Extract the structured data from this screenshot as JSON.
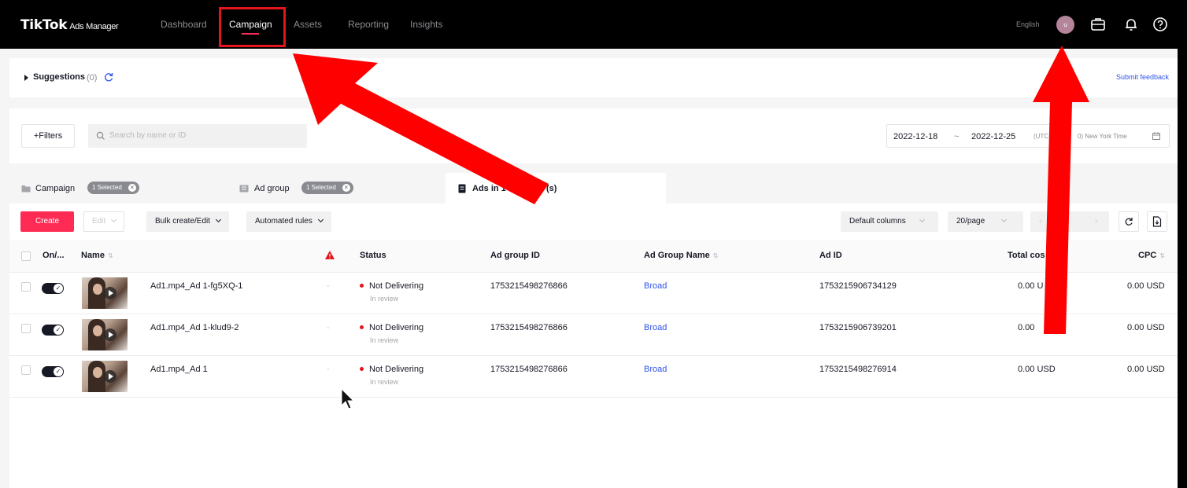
{
  "app": {
    "brand": "TikTok",
    "product": "Ads Manager"
  },
  "nav": {
    "items": [
      "Dashboard",
      "Campaign",
      "Assets",
      "Reporting",
      "Insights"
    ],
    "active": "Campaign",
    "language": "English",
    "avatar_initial": "u"
  },
  "suggestions": {
    "title": "Suggestions",
    "count": "(0)",
    "feedback": "Submit feedback"
  },
  "filters": {
    "button": "+Filters",
    "search_placeholder": "Search by name or ID",
    "date_start": "2022-12-18",
    "date_sep": "~",
    "date_end": "2022-12-25",
    "utc": "(UTC",
    "timezone": "0) New York Time"
  },
  "tabs": {
    "campaign": "Campaign",
    "campaign_chip": "1 Selected",
    "adgroup": "Ad group",
    "adgroup_chip": "1 Selected",
    "ads": "Ads in 1 C",
    "ads_tail": "(s)"
  },
  "toolbar": {
    "create": "Create",
    "edit": "Edit",
    "bulk": "Bulk create/Edit",
    "rules": "Automated rules",
    "columns": "Default columns",
    "perpage": "20/page",
    "page": "1"
  },
  "columns": [
    "On/...",
    "Name",
    "Status",
    "Ad group ID",
    "Ad Group Name",
    "Ad ID",
    "Total cos",
    "CPC"
  ],
  "rows": [
    {
      "name": "Ad1.mp4_Ad 1-fg5XQ-1",
      "issue": "-",
      "status": "Not Delivering",
      "status_sub": "In review",
      "adgroup_id": "1753215498276866",
      "adgroup_name": "Broad",
      "ad_id": "1753215906734129",
      "total_cost": "0.00 U",
      "cpc": "0.00 USD"
    },
    {
      "name": "Ad1.mp4_Ad 1-klud9-2",
      "issue": "-",
      "status": "Not Delivering",
      "status_sub": "In review",
      "adgroup_id": "1753215498276866",
      "adgroup_name": "Broad",
      "ad_id": "1753215906739201",
      "total_cost": "0.00",
      "cpc": "0.00 USD"
    },
    {
      "name": "Ad1.mp4_Ad 1",
      "issue": "-",
      "status": "Not Delivering",
      "status_sub": "In review",
      "adgroup_id": "1753215498276866",
      "adgroup_name": "Broad",
      "ad_id": "1753215498276914",
      "total_cost": "0.00 USD",
      "cpc": "0.00 USD"
    }
  ],
  "colors": {
    "brand": "#fe2c55",
    "annotation_red": "#ff0000",
    "link": "#2f54eb"
  }
}
